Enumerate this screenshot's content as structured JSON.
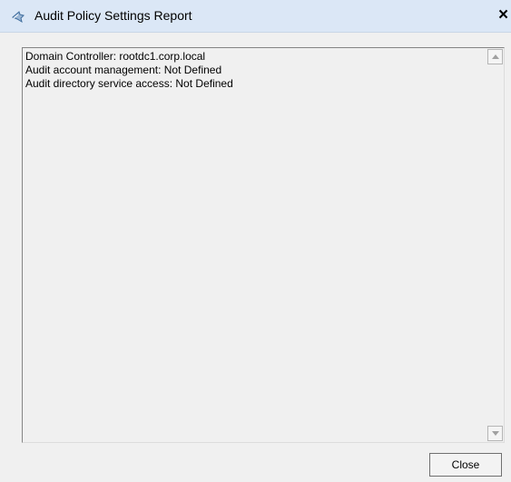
{
  "window": {
    "title": "Audit Policy Settings Report",
    "close_glyph": "×",
    "title_icon": "audit-app-icon"
  },
  "report": {
    "text": "Domain Controller: rootdc1.corp.local\nAudit account management: Not Defined\nAudit directory service access: Not Defined"
  },
  "buttons": {
    "close_label": "Close"
  },
  "colors": {
    "titlebar": "#dbe7f6",
    "window_background": "#f0f0f0"
  }
}
